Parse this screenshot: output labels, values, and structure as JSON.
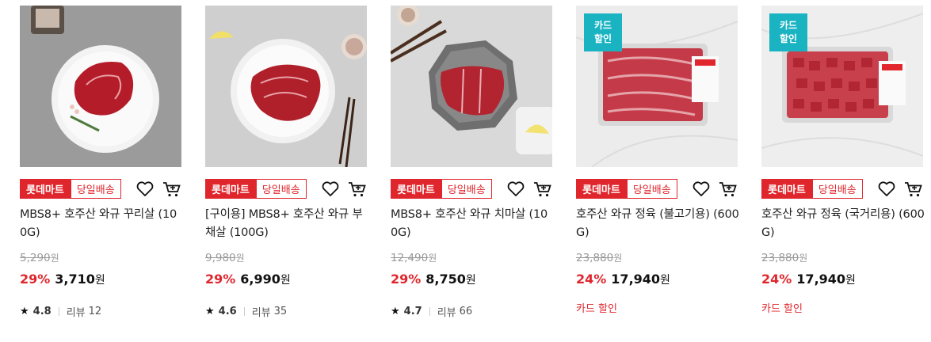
{
  "products": [
    {
      "mart_tag": "롯데마트",
      "delivery_tag": "당일배송",
      "title": "MBS8+ 호주산 와규 꾸리살 (100G)",
      "original_price": "5,290",
      "original_unit": "원",
      "discount_rate": "29%",
      "sale_price": "3,710",
      "sale_unit": "원",
      "rating": "4.8",
      "review_label": "리뷰",
      "review_count": "12",
      "heart_icon": "heart-outline-icon",
      "cart_icon": "cart-icon"
    },
    {
      "mart_tag": "롯데마트",
      "delivery_tag": "당일배송",
      "title": "[구이용] MBS8+ 호주산 와규 부채살 (100G)",
      "original_price": "9,980",
      "original_unit": "원",
      "discount_rate": "29%",
      "sale_price": "6,990",
      "sale_unit": "원",
      "rating": "4.6",
      "review_label": "리뷰",
      "review_count": "35",
      "heart_icon": "heart-outline-icon",
      "cart_icon": "cart-icon"
    },
    {
      "mart_tag": "롯데마트",
      "delivery_tag": "당일배송",
      "title": "MBS8+ 호주산 와규 치마살 (100G)",
      "original_price": "12,490",
      "original_unit": "원",
      "discount_rate": "29%",
      "sale_price": "8,750",
      "sale_unit": "원",
      "rating": "4.7",
      "review_label": "리뷰",
      "review_count": "66",
      "heart_icon": "heart-outline-icon",
      "cart_icon": "cart-icon"
    },
    {
      "badge": "카드\n할인",
      "mart_tag": "롯데마트",
      "delivery_tag": "당일배송",
      "title": "호주산 와규 정육 (불고기용) (600G)",
      "original_price": "23,880",
      "original_unit": "원",
      "discount_rate": "24%",
      "sale_price": "17,940",
      "sale_unit": "원",
      "card_sale": "카드 할인",
      "heart_icon": "heart-outline-icon",
      "cart_icon": "cart-icon"
    },
    {
      "badge": "카드\n할인",
      "mart_tag": "롯데마트",
      "delivery_tag": "당일배송",
      "title": "호주산 와규 정육 (국거리용) (600G)",
      "original_price": "23,880",
      "original_unit": "원",
      "discount_rate": "24%",
      "sale_price": "17,940",
      "sale_unit": "원",
      "card_sale": "카드 할인",
      "heart_icon": "heart-outline-icon",
      "cart_icon": "cart-icon"
    }
  ],
  "colors": {
    "accent": "#e0262d",
    "badge": "#19b3c2"
  }
}
